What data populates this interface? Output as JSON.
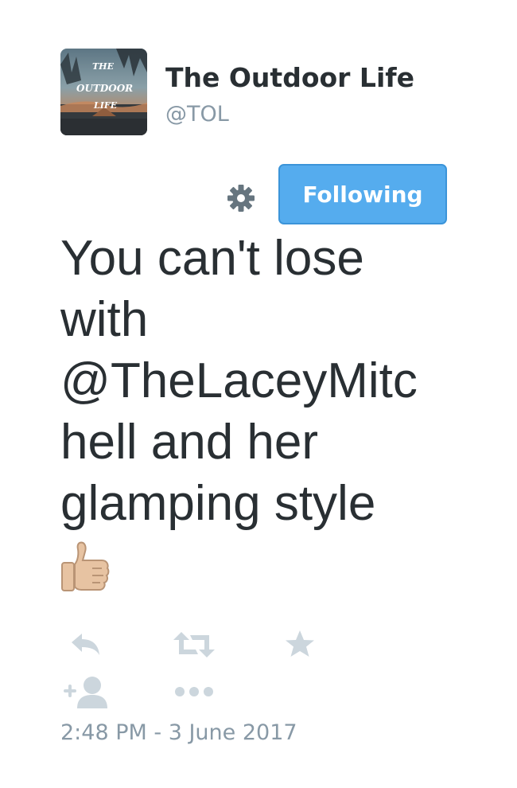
{
  "user": {
    "display_name": "The Outdoor Life",
    "handle": "@TOL",
    "avatar_text": [
      "THE",
      "OUTDOOR",
      "LIFE"
    ]
  },
  "follow_button": {
    "label": "Following"
  },
  "tweet": {
    "lines": [
      "You can't lose",
      "with",
      "@TheLaceyMitc",
      "hell and her",
      "glamping style"
    ],
    "emoji": "thumbs-up"
  },
  "actions": [
    "reply-icon",
    "retweet-icon",
    "favorite-icon",
    "follow-user-icon",
    "more-icon"
  ],
  "timestamp": "2:48 PM - 3 June 2017",
  "colors": {
    "text": "#292f33",
    "muted": "#8899a6",
    "action_icon": "#ccd6dd",
    "follow_button_bg": "#55acee",
    "follow_button_border": "#3b94d9"
  }
}
